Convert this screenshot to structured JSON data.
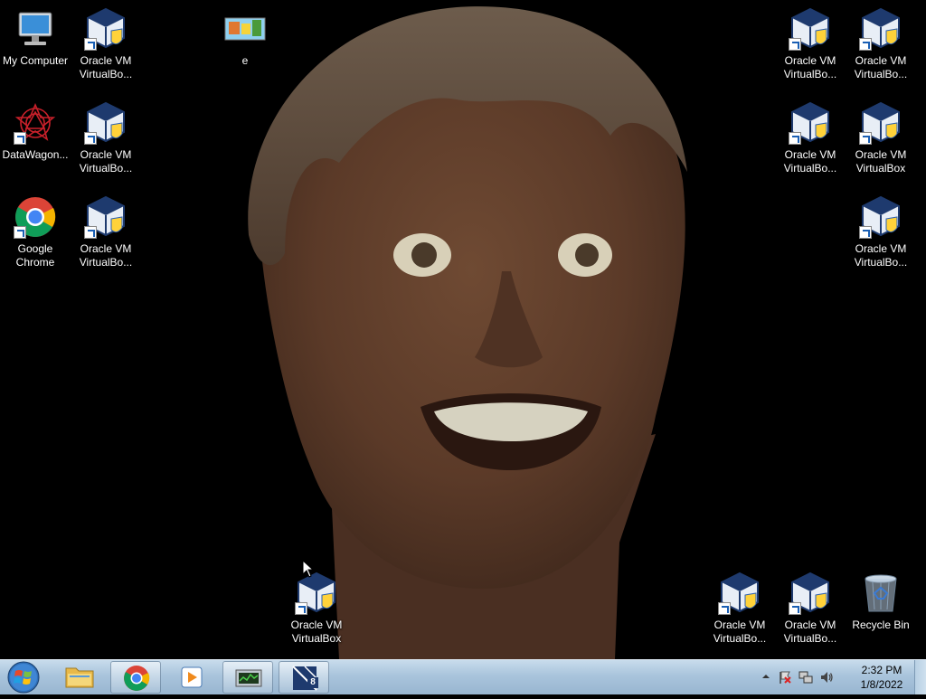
{
  "desktop": {
    "icons": [
      {
        "id": "my-computer",
        "label": "My Computer",
        "type": "computer"
      },
      {
        "id": "vbox-1",
        "label": "Oracle VM\nVirtualBo...",
        "type": "virtualbox"
      },
      {
        "id": "e",
        "label": "e",
        "type": "image"
      },
      {
        "id": "vbox-tr1",
        "label": "Oracle VM\nVirtualBo...",
        "type": "virtualbox"
      },
      {
        "id": "vbox-tr2",
        "label": "Oracle VM\nVirtualBo...",
        "type": "virtualbox"
      },
      {
        "id": "datawagon",
        "label": "DataWagon...",
        "type": "datawagon"
      },
      {
        "id": "vbox-2",
        "label": "Oracle VM\nVirtualBo...",
        "type": "virtualbox"
      },
      {
        "id": "vbox-tr3",
        "label": "Oracle VM\nVirtualBo...",
        "type": "virtualbox"
      },
      {
        "id": "vbox-tr4",
        "label": "Oracle VM\nVirtualBox",
        "type": "virtualbox"
      },
      {
        "id": "google-chrome",
        "label": "Google\nChrome",
        "type": "chrome"
      },
      {
        "id": "vbox-3",
        "label": "Oracle VM\nVirtualBo...",
        "type": "virtualbox"
      },
      {
        "id": "vbox-tr5",
        "label": "Oracle VM\nVirtualBo...",
        "type": "virtualbox"
      },
      {
        "id": "vbox-bottom",
        "label": "Oracle VM\nVirtualBox",
        "type": "virtualbox"
      },
      {
        "id": "vbox-br1",
        "label": "Oracle VM\nVirtualBo...",
        "type": "virtualbox"
      },
      {
        "id": "vbox-br2",
        "label": "Oracle VM\nVirtualBo...",
        "type": "virtualbox"
      },
      {
        "id": "recycle-bin",
        "label": "Recycle Bin",
        "type": "recycle-bin"
      }
    ]
  },
  "taskbar": {
    "start_icon": "windows-logo-icon",
    "pinned": [
      {
        "name": "windows-explorer",
        "icon": "folder-icon"
      },
      {
        "name": "google-chrome",
        "icon": "chrome-icon"
      },
      {
        "name": "media-player",
        "icon": "media-player-icon"
      },
      {
        "name": "task-manager",
        "icon": "task-manager-icon"
      },
      {
        "name": "virtualbox-manager",
        "icon": "virtualbox-icon",
        "badge": "8"
      }
    ],
    "tray": {
      "icons": [
        "show-hidden-icons-icon",
        "action-center-flag-icon",
        "network-icon",
        "volume-icon"
      ],
      "time": "2:32 PM",
      "date": "1/8/2022"
    }
  },
  "colors": {
    "vbox_blue": "#1e3a6e",
    "taskbar": "#a9c4dc",
    "desktop": "#000000"
  }
}
